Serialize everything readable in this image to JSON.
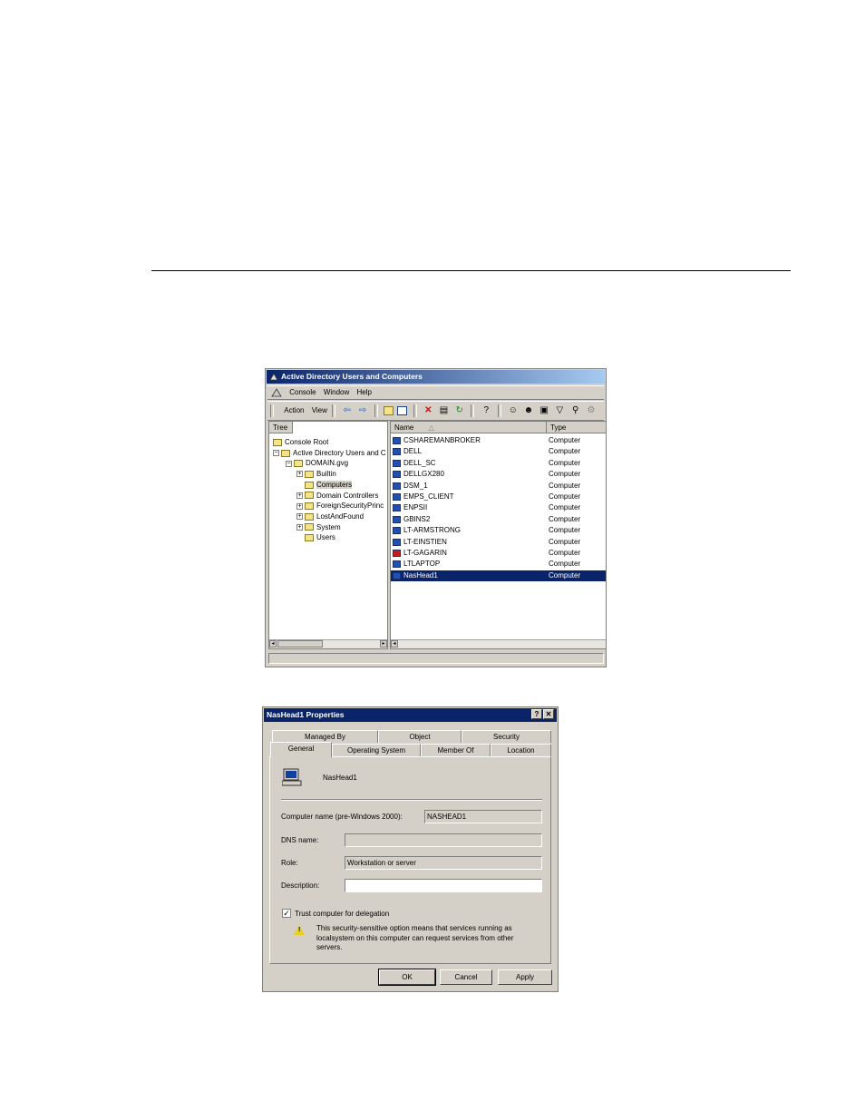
{
  "mmc": {
    "title": "Active Directory Users and Computers",
    "menu": {
      "console": "Console",
      "window": "Window",
      "help": "Help"
    },
    "toolbar": {
      "action": "Action",
      "view": "View"
    },
    "tree_header": "Tree",
    "tree": [
      {
        "label": "Console Root",
        "level": 0,
        "expander": ""
      },
      {
        "label": "Active Directory Users and C",
        "level": 1,
        "expander": "−"
      },
      {
        "label": "DOMAIN.gvg",
        "level": 2,
        "expander": "−"
      },
      {
        "label": "Builtin",
        "level": 3,
        "expander": "+"
      },
      {
        "label": "Computers",
        "level": 3,
        "expander": "",
        "selected": true
      },
      {
        "label": "Domain Controllers",
        "level": 3,
        "expander": "+"
      },
      {
        "label": "ForeignSecurityPrinc",
        "level": 3,
        "expander": "+"
      },
      {
        "label": "LostAndFound",
        "level": 3,
        "expander": "+"
      },
      {
        "label": "System",
        "level": 3,
        "expander": "+"
      },
      {
        "label": "Users",
        "level": 3,
        "expander": ""
      }
    ],
    "list_header": {
      "name": "Name",
      "sort_glyph": "△",
      "type": "Type"
    },
    "list": [
      {
        "name": "CSHAREMANBROKER",
        "type": "Computer"
      },
      {
        "name": "DELL",
        "type": "Computer"
      },
      {
        "name": "DELL_SC",
        "type": "Computer"
      },
      {
        "name": "DELLGX280",
        "type": "Computer"
      },
      {
        "name": "DSM_1",
        "type": "Computer"
      },
      {
        "name": "EMPS_CLIENT",
        "type": "Computer"
      },
      {
        "name": "ENPSII",
        "type": "Computer"
      },
      {
        "name": "GBINS2",
        "type": "Computer"
      },
      {
        "name": "LT-ARMSTRONG",
        "type": "Computer"
      },
      {
        "name": "LT-EINSTIEN",
        "type": "Computer"
      },
      {
        "name": "LT-GAGARIN",
        "type": "Computer",
        "disabled": true
      },
      {
        "name": "LTLAPTOP",
        "type": "Computer"
      },
      {
        "name": "NasHead1",
        "type": "Computer",
        "selected": true
      }
    ]
  },
  "dialog": {
    "title": "NasHead1 Properties",
    "help_btn": "?",
    "close_btn": "✕",
    "tabs_back": [
      "Managed By",
      "Object",
      "Security"
    ],
    "tabs_front": [
      "General",
      "Operating System",
      "Member Of",
      "Location"
    ],
    "computer_label": "NasHead1",
    "fields": {
      "pre2000_label": "Computer name (pre-Windows 2000):",
      "pre2000_value": "NASHEAD1",
      "dns_label": "DNS name:",
      "dns_value": "",
      "role_label": "Role:",
      "role_value": "Workstation or server",
      "desc_label": "Description:",
      "desc_value": ""
    },
    "trust_label": "Trust computer for delegation",
    "trust_checked": "✓",
    "warning_text": "This security-sensitive option means that services running as localsystem on this computer can request services from other servers.",
    "buttons": {
      "ok": "OK",
      "cancel": "Cancel",
      "apply": "Apply"
    }
  }
}
